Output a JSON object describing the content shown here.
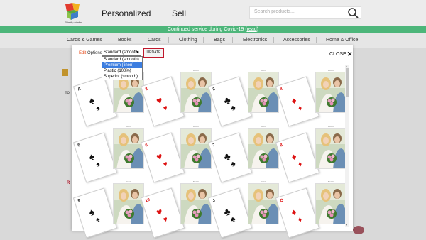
{
  "header": {
    "nav": [
      "Personalized",
      "Sell"
    ],
    "search_placeholder": "Search products..."
  },
  "banner": {
    "text": "Continued service during Covid-19 (",
    "link": "read",
    "close_paren": ")"
  },
  "categories": [
    "Cards & Games",
    "Books",
    "Cards",
    "Clothing",
    "Bags",
    "Electronics",
    "Accessories",
    "Home & Office"
  ],
  "background_text": {
    "left_snippet": "Yo",
    "red_letter": "R"
  },
  "modal": {
    "edit_label": "Edit",
    "options_label": "Options",
    "selected_option": "Standard (smooth)",
    "options": [
      "Standard (smooth)",
      "Premium (linen)",
      "Plastic (100%)",
      "Superior (smooth)"
    ],
    "highlighted_index": 1,
    "update_label": "UPDATE",
    "close_label": "CLOSE"
  },
  "cards": [
    {
      "rank": "A",
      "suit": "♠",
      "color": "#111"
    },
    {
      "rank": "2",
      "suit": "♥",
      "color": "#d11"
    },
    {
      "rank": "3",
      "suit": "♣",
      "color": "#111"
    },
    {
      "rank": "4",
      "suit": "♦",
      "color": "#d11"
    },
    {
      "rank": "5",
      "suit": "♠",
      "color": "#111"
    },
    {
      "rank": "6",
      "suit": "♥",
      "color": "#d11"
    },
    {
      "rank": "7",
      "suit": "♣",
      "color": "#111"
    },
    {
      "rank": "8",
      "suit": "♦",
      "color": "#d11"
    },
    {
      "rank": "9",
      "suit": "♠",
      "color": "#111"
    },
    {
      "rank": "10",
      "suit": "♥",
      "color": "#d11"
    },
    {
      "rank": "J",
      "suit": "♣",
      "color": "#111"
    },
    {
      "rank": "Q",
      "suit": "♦",
      "color": "#d11"
    }
  ],
  "photo_label": "BACK",
  "colors": {
    "banner": "#4db67a",
    "accent_red": "#c0182c",
    "edit_orange": "#e8582a",
    "highlight": "#3b7de0"
  }
}
